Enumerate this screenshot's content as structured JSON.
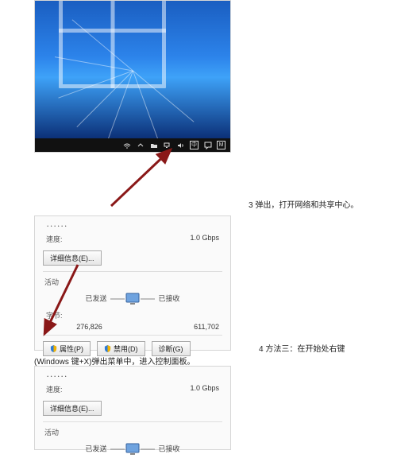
{
  "captions": {
    "step3": "3 弹出，打开网络和共享中心。",
    "step4": "4 方法三：在开始处右键",
    "winx": "(Windows 键+X)弹出菜单中，进入控制面板。"
  },
  "taskbar_icons": [
    "wifi-icon",
    "chevron-up-icon",
    "folder-icon",
    "network-icon",
    "volume-icon",
    "ime-icon",
    "action-center-icon",
    "m-icon"
  ],
  "dialog1": {
    "speed_label": "速度:",
    "speed_value": "1.0 Gbps",
    "details_button": "详细信息(E)...",
    "activity_label": "活动",
    "sent_label": "已发送",
    "recv_label": "已接收",
    "sent_value": "276,826",
    "recv_value": "611,702",
    "bytes_label": "字节:",
    "properties_button": "属性(P)",
    "disable_button": "禁用(D)",
    "diagnose_button": "诊断(G)"
  },
  "dialog2": {
    "speed_label": "速度:",
    "speed_value": "1.0 Gbps",
    "details_button": "详细信息(E)...",
    "activity_label": "活动",
    "sent_label": "已发送",
    "recv_label": "已接收"
  }
}
